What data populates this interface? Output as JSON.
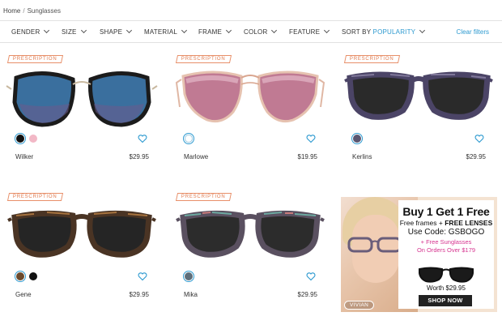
{
  "breadcrumb": {
    "home": "Home",
    "separator": "/",
    "current": "Sunglasses"
  },
  "filters": [
    {
      "label": "GENDER"
    },
    {
      "label": "SIZE"
    },
    {
      "label": "SHAPE"
    },
    {
      "label": "MATERIAL"
    },
    {
      "label": "FRAME"
    },
    {
      "label": "COLOR"
    },
    {
      "label": "FEATURE"
    }
  ],
  "sort": {
    "label": "SORT BY",
    "value": "POPULARITY"
  },
  "clear_label": "Clear filters",
  "badge_label": "PRESCRIPTION",
  "products": [
    {
      "name": "Wilker",
      "price": "$29.95",
      "badge": true,
      "swatches": [
        "#111111",
        "#f2b8c6"
      ],
      "frame_color": "#1b1b1b",
      "lens_color": "#3a6f9e",
      "temple_color": "#c9b9a0"
    },
    {
      "name": "Marlowe",
      "price": "$19.95",
      "badge": true,
      "swatches": [
        "#ffffff"
      ],
      "frame_color": "#e6c2b0",
      "lens_color": "#c07a93",
      "temple_color": "#e0b7a4"
    },
    {
      "name": "Kerlins",
      "price": "$29.95",
      "badge": true,
      "swatches": [
        "#5b5670"
      ],
      "frame_color": "#4b4466",
      "lens_color": "#2a2a2a",
      "temple_color": "#4b4466"
    },
    {
      "name": "Gene",
      "price": "$29.95",
      "badge": true,
      "swatches": [
        "#6b4a2e",
        "#111111"
      ],
      "frame_color": "#4a3424",
      "lens_color": "#252525",
      "temple_color": "#4a3424"
    },
    {
      "name": "Mika",
      "price": "$29.95",
      "badge": true,
      "swatches": [
        "#5e6e7a"
      ],
      "frame_color": "#5a5060",
      "lens_color": "#2c2c2c",
      "temple_color": "#5a5060"
    }
  ],
  "ad": {
    "model_name": "VIVIAN",
    "headline": "Buy 1 Get 1 Free",
    "subhead_prefix": "Free frames + ",
    "subhead_bold": "FREE LENSES",
    "code": "Use Code: GSBOGO",
    "promo_line1": "+ Free Sunglasses",
    "promo_line2": "On Orders Over $179",
    "worth": "Worth $29.95",
    "cta": "SHOP NOW"
  }
}
